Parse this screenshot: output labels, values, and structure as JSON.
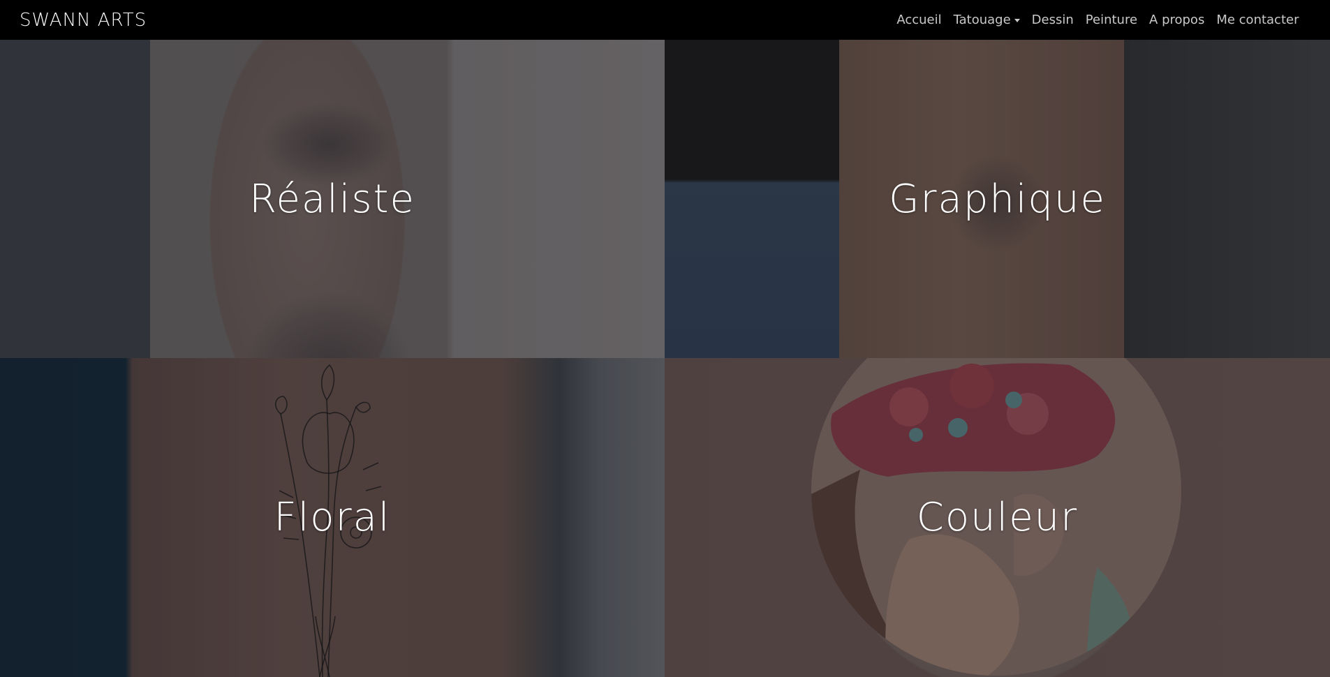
{
  "site": {
    "brand": "SWANN ARTS"
  },
  "nav": {
    "items": [
      {
        "label": "Accueil"
      },
      {
        "label": "Tatouage",
        "dropdown": true
      },
      {
        "label": "Dessin"
      },
      {
        "label": "Peinture"
      },
      {
        "label": "A propos"
      },
      {
        "label": "Me contacter"
      }
    ]
  },
  "tiles": [
    {
      "title": "Réaliste"
    },
    {
      "title": "Graphique"
    },
    {
      "title": "Floral"
    },
    {
      "title": "Couleur"
    }
  ],
  "colors": {
    "navbar_bg": "#000000",
    "nav_text": "#c9c9c9",
    "brand_text": "#ffffff",
    "tile_title": "#ffffff"
  },
  "icons": {
    "dropdown": "caret-down-icon"
  }
}
